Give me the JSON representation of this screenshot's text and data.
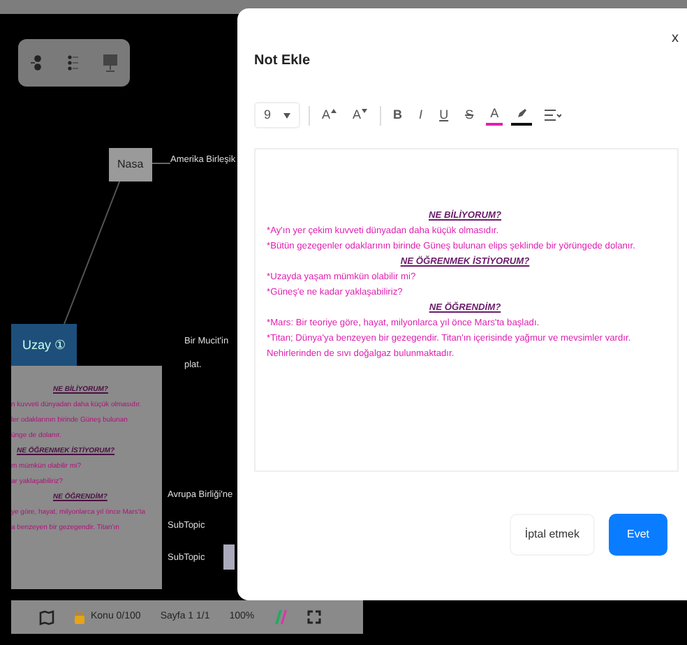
{
  "canvas": {
    "nodes": [
      {
        "label": "Nasa",
        "kind": "box"
      },
      {
        "label": "Amerika Birleşik",
        "kind": "text"
      },
      {
        "label": "Uzay ①",
        "kind": "root"
      },
      {
        "label": "Bir Mucit'in",
        "kind": "text"
      },
      {
        "label": "plat.",
        "kind": "text"
      },
      {
        "label": "Avrupa Birliği'ne",
        "kind": "text"
      },
      {
        "label": "SubTopic",
        "kind": "text"
      },
      {
        "label": "SubTopic",
        "kind": "text"
      }
    ],
    "note_preview": {
      "lines": [
        {
          "text": "NE BİLİYORUM?",
          "kind": "heading"
        },
        {
          "text": "n kuvveti dünyadan daha küçük olmasıdır.",
          "kind": "body"
        },
        {
          "text": "ler odaklarının birinde Güneş bulunan",
          "kind": "body"
        },
        {
          "text": "ünge de dolanır.",
          "kind": "body"
        },
        {
          "text": "NE ÖĞRENMEK İSTİYORUM?",
          "kind": "heading"
        },
        {
          "text": "m mümkün olabilir mi?",
          "kind": "body"
        },
        {
          "text": "ar yaklaşabiliriz?",
          "kind": "body"
        },
        {
          "text": "NE ÖĞRENDİM?",
          "kind": "heading"
        },
        {
          "text": "ye göre, hayat, milyonlarca yıl önce Mars'ta",
          "kind": "body"
        },
        {
          "text": "a benzeyen bir gezegendir. Titan'ın",
          "kind": "body"
        }
      ]
    }
  },
  "bottom_bar": {
    "topic_count": "Konu 0/100",
    "page": "Sayfa 1 1/1",
    "zoom": "100%"
  },
  "dialog": {
    "title": "Not Ekle",
    "close": "x",
    "toolbar": [
      {
        "kind": "dropdown",
        "label": "9"
      },
      {
        "kind": "grow",
        "label": "A"
      },
      {
        "kind": "shrink",
        "label": "A"
      },
      {
        "kind": "bold",
        "label": "B"
      },
      {
        "kind": "italic",
        "label": "I"
      },
      {
        "kind": "underline",
        "label": "U"
      },
      {
        "kind": "strike",
        "label": "S"
      },
      {
        "kind": "color",
        "label": "A",
        "color": "#e020b0"
      },
      {
        "kind": "highlight",
        "color": "#111111"
      },
      {
        "kind": "align"
      }
    ],
    "content": [
      {
        "kind": "heading",
        "text": "NE BİLİYORUM?"
      },
      {
        "kind": "body",
        "text": "*Ay'ın yer çekim kuvveti dünyadan daha küçük olmasıdır."
      },
      {
        "kind": "body",
        "text": "*Bütün gezegenler odaklarının birinde Güneş bulunan elips şeklinde bir yörüngede dolanır."
      },
      {
        "kind": "heading",
        "text": "NE ÖĞRENMEK İSTİYORUM?"
      },
      {
        "kind": "body",
        "text": "*Uzayda yaşam mümkün olabilir mi?"
      },
      {
        "kind": "body",
        "text": "*Güneş'e ne kadar yaklaşabiliriz?"
      },
      {
        "kind": "heading",
        "text": "NE ÖĞRENDİM?"
      },
      {
        "kind": "body",
        "text": "*Mars: Bir teoriye göre, hayat, milyonlarca yıl önce Mars'ta başladı."
      },
      {
        "kind": "body",
        "text": "*Titan; Dünya'ya benzeyen bir gezegendir. Titan'ın içerisinde yağmur ve mevsimler vardır. Nehirlerinden de sıvı doğalgaz bulunmaktadır."
      }
    ],
    "buttons": [
      {
        "kind": "secondary",
        "label": "İptal etmek"
      },
      {
        "kind": "primary",
        "label": "Evet"
      }
    ]
  }
}
